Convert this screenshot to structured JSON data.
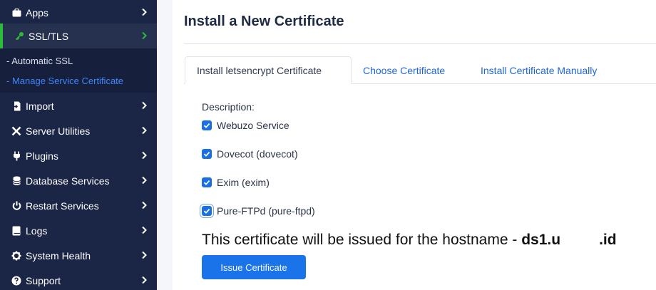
{
  "sidebar": {
    "items": [
      {
        "label": "Apps",
        "icon": "briefcase-icon"
      },
      {
        "label": "SSL/TLS",
        "icon": "key-icon",
        "active": true
      },
      {
        "label": "Import",
        "icon": "import-icon"
      },
      {
        "label": "Server Utilities",
        "icon": "tools-icon"
      },
      {
        "label": "Plugins",
        "icon": "plug-icon"
      },
      {
        "label": "Database Services",
        "icon": "database-icon"
      },
      {
        "label": "Restart Services",
        "icon": "power-icon"
      },
      {
        "label": "Logs",
        "icon": "book-icon"
      },
      {
        "label": "System Health",
        "icon": "gear-icon"
      },
      {
        "label": "Support",
        "icon": "question-icon"
      }
    ],
    "ssl_submenu": [
      {
        "label": "- Automatic SSL"
      },
      {
        "label": "- Manage Service Certificate",
        "current": true
      }
    ]
  },
  "page": {
    "title": "Install a New Certificate"
  },
  "tabs": [
    {
      "label": "Install letsencrypt Certificate",
      "active": true
    },
    {
      "label": "Choose Certificate"
    },
    {
      "label": "Install Certificate Manually"
    }
  ],
  "form": {
    "description_label": "Description:",
    "services": [
      {
        "label": "Webuzo Service",
        "checked": true
      },
      {
        "label": "Dovecot (dovecot)",
        "checked": true
      },
      {
        "label": "Exim (exim)",
        "checked": true
      },
      {
        "label": "Pure-FTPd (pure-ftpd)",
        "checked": true
      }
    ],
    "hostname_text": "This certificate will be issued for the hostname - ",
    "hostname_part1": "ds1.u",
    "hostname_part2": ".id",
    "issue_button": "Issue Certificate"
  },
  "colors": {
    "sidebar_bg": "#1b2546",
    "active_accent": "#2bbd3a",
    "link_blue": "#1d66d8",
    "button_blue": "#1a73e8"
  }
}
